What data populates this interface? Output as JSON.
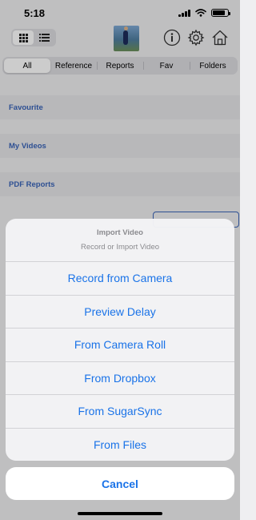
{
  "status": {
    "time": "5:18",
    "battery_level": 0.85
  },
  "toolbar": {
    "grid_view_icon": "grid-icon",
    "list_view_icon": "list-icon",
    "info_icon": "info-icon",
    "settings_icon": "gear-icon",
    "home_icon": "home-icon"
  },
  "tabs": [
    {
      "label": "All",
      "active": true
    },
    {
      "label": "Reference",
      "active": false
    },
    {
      "label": "Reports",
      "active": false
    },
    {
      "label": "Fav",
      "active": false
    },
    {
      "label": "Folders",
      "active": false
    }
  ],
  "sections": {
    "favourite": "Favourite",
    "my_videos": "My Videos",
    "pdf_reports": "PDF Reports"
  },
  "sheet": {
    "title": "Import Video",
    "message": "Record or Import Video",
    "actions": [
      "Record from Camera",
      "Preview Delay",
      "From Camera Roll",
      "From Dropbox",
      "From SugarSync",
      "From Files"
    ],
    "cancel": "Cancel"
  },
  "colors": {
    "accent": "#1a73e8",
    "section_text": "#3a64b8"
  }
}
